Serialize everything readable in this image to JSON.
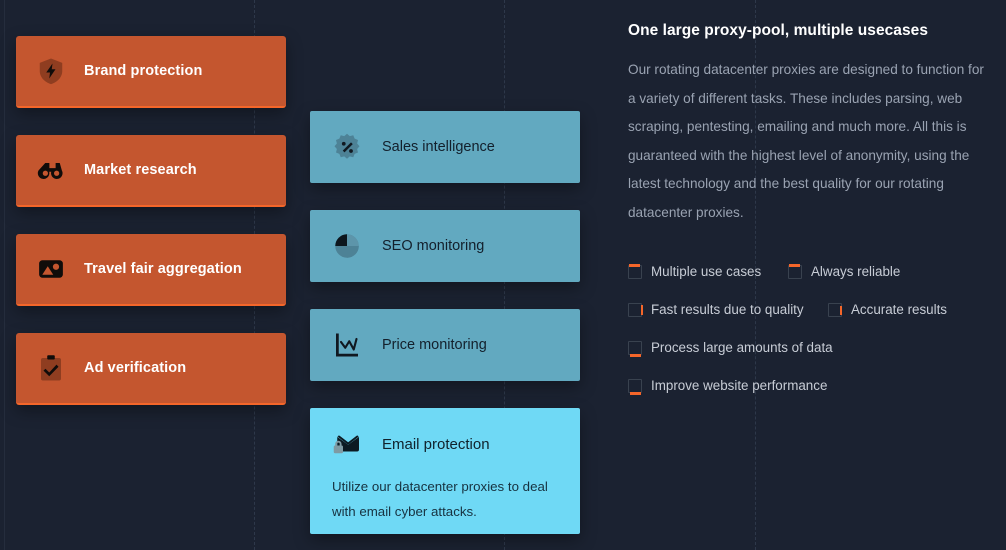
{
  "theme": {
    "background": "#1b2231",
    "orange_card": "#c4562f",
    "orange_accent": "#f4662a",
    "blue_card": "#62a9c0",
    "blue_active": "#6fd9f5",
    "heading_text": "#ffffff",
    "body_text": "#9aa3b2"
  },
  "left_column": {
    "cards": [
      {
        "label": "Brand protection",
        "icon": "shield-bolt-icon"
      },
      {
        "label": "Market research",
        "icon": "binoculars-icon"
      },
      {
        "label": "Travel fair aggregation",
        "icon": "image-icon"
      },
      {
        "label": "Ad verification",
        "icon": "clipboard-check-icon"
      }
    ]
  },
  "middle_column": {
    "cards": [
      {
        "label": "Sales intelligence",
        "icon": "badge-percent-icon"
      },
      {
        "label": "SEO monitoring",
        "icon": "pie-chart-icon"
      },
      {
        "label": "Price monitoring",
        "icon": "line-chart-icon"
      }
    ],
    "active_card": {
      "label": "Email protection",
      "icon": "email-lock-icon",
      "description": "Utilize our datacenter proxies to deal with email cyber attacks."
    }
  },
  "right_column": {
    "heading": "One large proxy-pool, multiple usecases",
    "paragraph": "Our rotating datacenter proxies are designed to function for a variety of different tasks. These includes parsing, web scraping, pentesting, emailing and much more. All this is guaranteed with the highest level of anonymity, using the latest technology and the best quality for our rotating datacenter proxies.",
    "checklist": [
      {
        "label": "Multiple use cases"
      },
      {
        "label": "Always reliable"
      },
      {
        "label": "Fast results due to quality"
      },
      {
        "label": "Accurate results"
      },
      {
        "label": "Process large amounts of data"
      },
      {
        "label": "Improve website performance"
      }
    ]
  }
}
